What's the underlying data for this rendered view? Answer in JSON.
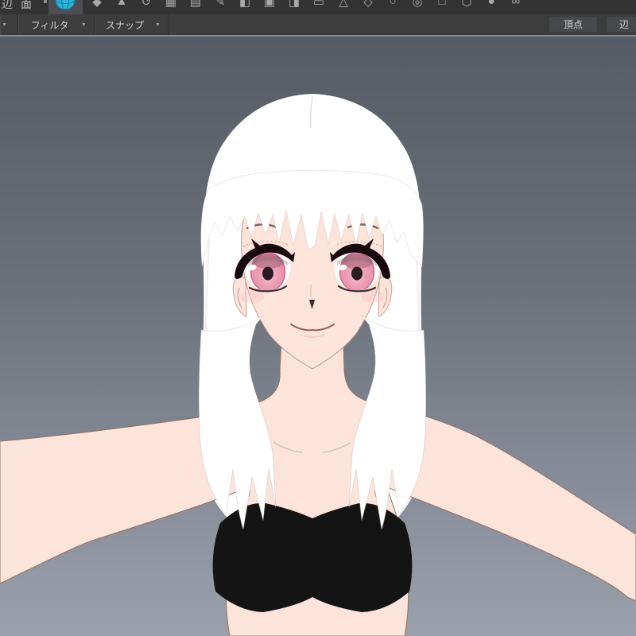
{
  "toolbar_top": {
    "partial_labels": [
      {
        "label": "辺"
      },
      {
        "label": "面"
      }
    ],
    "active_tool_icon": "sphere-world-icon",
    "icons": [
      {
        "name": "tool-icon-1",
        "glyph": "◆"
      },
      {
        "name": "tool-icon-2",
        "glyph": "▲"
      },
      {
        "name": "tool-icon-3",
        "glyph": "↺"
      },
      {
        "name": "tool-icon-4",
        "glyph": "▦"
      },
      {
        "name": "tool-icon-5",
        "glyph": "▤"
      },
      {
        "name": "tool-icon-6",
        "glyph": "✎"
      },
      {
        "name": "tool-icon-7",
        "glyph": "◧"
      },
      {
        "name": "tool-icon-8",
        "glyph": "▣"
      },
      {
        "name": "tool-icon-9",
        "glyph": "◨"
      },
      {
        "name": "tool-icon-10",
        "glyph": "▭"
      },
      {
        "name": "tool-icon-11",
        "glyph": "△"
      },
      {
        "name": "tool-icon-12",
        "glyph": "◇"
      },
      {
        "name": "tool-icon-13",
        "glyph": "○"
      },
      {
        "name": "tool-icon-14",
        "glyph": "◎"
      },
      {
        "name": "tool-icon-15",
        "glyph": "□"
      },
      {
        "name": "tool-icon-16",
        "glyph": "⬡"
      },
      {
        "name": "tool-icon-17",
        "glyph": "●"
      },
      {
        "name": "tool-icon-18",
        "glyph": "∞"
      }
    ]
  },
  "toolbar_second": {
    "left_partial_arrow": "▼",
    "dropdowns": [
      {
        "label": "フィルタ",
        "arrow": "▼"
      },
      {
        "label": "スナップ",
        "arrow": "▼"
      }
    ],
    "right_buttons": [
      {
        "label": "頂点"
      },
      {
        "label": "辺"
      }
    ]
  },
  "viewport": {
    "content": "anime-girl-3d-model"
  },
  "colors": {
    "accent": "#2fb3d8",
    "accent-dark": "#0e7d9e",
    "toolbar1-bg": "#333333",
    "toolbar2-bg": "#3d3d3d",
    "vp-top": "#565b64",
    "vp-bottom": "#9ba1ac",
    "hair": "#ffffff",
    "skin": "#fce4da",
    "skin-line": "rgba(139,105,90,0.85)",
    "iris-pink": "#e793ab",
    "iris-rim": "#c96a8d",
    "pupil": "#2c1b23",
    "lash": "#17090d",
    "top-black": "#141414"
  }
}
